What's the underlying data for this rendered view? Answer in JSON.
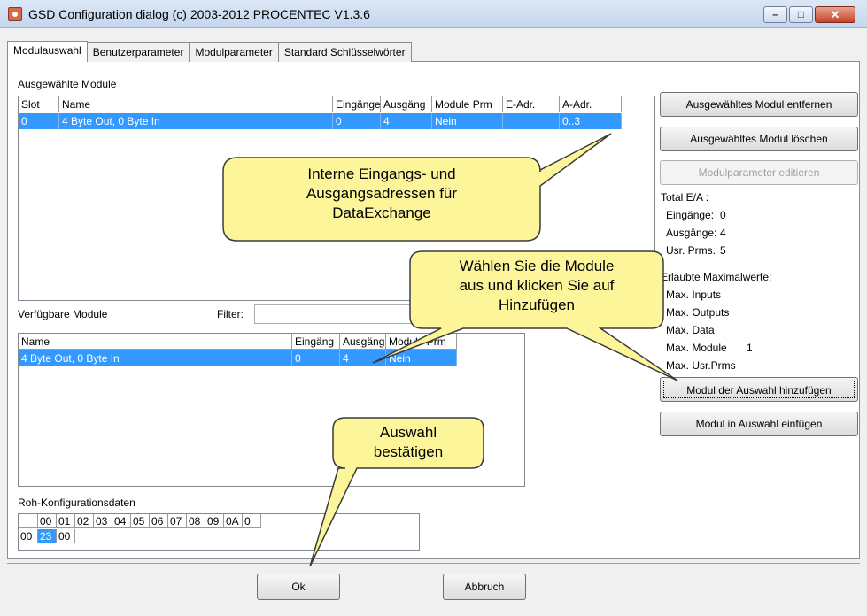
{
  "window": {
    "title": "GSD Configuration dialog (c) 2003-2012 PROCENTEC V1.3.6",
    "min_glyph": "–",
    "max_glyph": "□",
    "close_glyph": "✕"
  },
  "tabs": [
    {
      "label": "Modulauswahl"
    },
    {
      "label": "Benutzerparameter"
    },
    {
      "label": "Modulparameter"
    },
    {
      "label": "Standard Schlüsselwörter"
    }
  ],
  "selected_modules": {
    "label": "Ausgewählte Module",
    "columns": [
      "Slot",
      "Name",
      "Eingänge",
      "Ausgäng",
      "Module Prm",
      "E-Adr.",
      "A-Adr."
    ],
    "rows": [
      {
        "slot": "0",
        "name": "4 Byte Out, 0 Byte In",
        "in": "0",
        "out": "4",
        "prm": "Nein",
        "eadr": "",
        "aadr": "0..3"
      }
    ]
  },
  "available_modules": {
    "label": "Verfügbare Module",
    "filter_label": "Filter:",
    "filter_value": "",
    "columns": [
      "Name",
      "Eingäng",
      "Ausgäng",
      "Module Prm"
    ],
    "rows": [
      {
        "name": "4 Byte Out, 0 Byte In",
        "in": "0",
        "out": "4",
        "prm": "Nein"
      }
    ]
  },
  "actions": {
    "remove_selected": "Ausgewähltes Modul entfernen",
    "delete_selected": "Ausgewähltes Modul löschen",
    "edit_params": "Modulparameter editieren",
    "add_to_selection": "Modul der Auswahl hinzufügen",
    "insert_into_selection": "Modul in Auswahl einfügen"
  },
  "totals": {
    "label": "Total E/A :",
    "inputs_label": "Eingänge:",
    "inputs_value": "0",
    "outputs_label": "Ausgänge:",
    "outputs_value": "4",
    "usr_prms_label": "Usr. Prms.",
    "usr_prms_value": "5"
  },
  "max_values": {
    "label": "Erlaubte Maximalwerte:",
    "max_inputs": "Max. Inputs",
    "max_outputs": "Max. Outputs",
    "max_data": "Max. Data",
    "max_module": "Max. Module",
    "max_module_value": "1",
    "max_usr_prms": "Max. Usr.Prms"
  },
  "raw_config": {
    "label": "Roh-Konfigurationsdaten",
    "col_headers": [
      "00",
      "01",
      "02",
      "03",
      "04",
      "05",
      "06",
      "07",
      "08",
      "09",
      "0A",
      "0"
    ],
    "row_header": "00",
    "values": [
      "23",
      "00"
    ]
  },
  "footer": {
    "ok": "Ok",
    "cancel": "Abbruch"
  },
  "callouts": {
    "addresses": [
      "Interne Eingangs- und",
      "Ausgangsadressen für",
      "DataExchange"
    ],
    "select_add": [
      "Wählen Sie die Module",
      "aus und klicken Sie  auf",
      "Hinzufügen"
    ],
    "confirm": [
      "Auswahl",
      "bestätigen"
    ]
  },
  "colors": {
    "selection": "#3399ff",
    "callout_fill": "#fdf59a",
    "callout_border": "#3b3b3b"
  }
}
